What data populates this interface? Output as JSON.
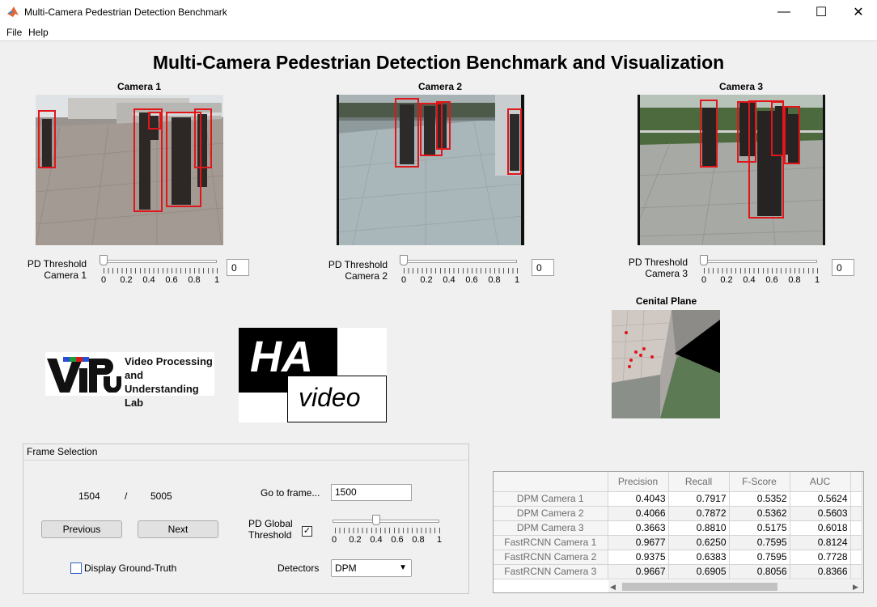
{
  "window": {
    "title": "Multi-Camera Pedestrian Detection Benchmark",
    "minimize": "—",
    "maximize": "☐",
    "close": "✕"
  },
  "menu": {
    "file": "File",
    "help": "Help"
  },
  "page_title": "Multi-Camera Pedestrian Detection Benchmark and Visualization",
  "cameras": [
    {
      "title": "Camera 1",
      "slider_label_1": "PD Threshold",
      "slider_label_2": "Camera 1",
      "value": "0",
      "level": 0
    },
    {
      "title": "Camera 2",
      "slider_label_1": "PD Threshold",
      "slider_label_2": "Camera 2",
      "value": "0",
      "level": 0
    },
    {
      "title": "Camera 3",
      "slider_label_1": "PD Threshold",
      "slider_label_2": "Camera 3",
      "value": "0",
      "level": 0
    }
  ],
  "slider_ticks": [
    "0",
    "0.2",
    "0.4",
    "0.6",
    "0.8",
    "1"
  ],
  "logos": {
    "vpu_text_1": "Video Processing",
    "vpu_text_2": "and Understanding",
    "vpu_text_3": "Lab",
    "vpu_mark": "ViPU",
    "hav_1": "HA",
    "hav_2": "video"
  },
  "cenital_title": "Cenital Plane",
  "frame_panel": {
    "title": "Frame Selection",
    "current_frame": "1504",
    "separator": "/",
    "total_frames": "5005",
    "goto_label": "Go to frame...",
    "goto_value": "1500",
    "previous": "Previous",
    "next": "Next",
    "global_threshold_1": "PD Global",
    "global_threshold_2": "Threshold",
    "global_threshold_checked": "✓",
    "global_threshold_level": 0.4,
    "display_gt": "Display Ground-Truth",
    "detectors_label": "Detectors",
    "detectors_value": "DPM",
    "dropdown_arrow": "▼"
  },
  "results_table": {
    "columns": [
      "Precision",
      "Recall",
      "F-Score",
      "AUC"
    ],
    "rows": [
      {
        "name": "DPM Camera 1",
        "values": [
          "0.4043",
          "0.7917",
          "0.5352",
          "0.5624"
        ]
      },
      {
        "name": "DPM Camera 2",
        "values": [
          "0.4066",
          "0.7872",
          "0.5362",
          "0.5603"
        ]
      },
      {
        "name": "DPM Camera 3",
        "values": [
          "0.3663",
          "0.8810",
          "0.5175",
          "0.6018"
        ]
      },
      {
        "name": "FastRCNN Camera 1",
        "values": [
          "0.9677",
          "0.6250",
          "0.7595",
          "0.8124"
        ]
      },
      {
        "name": "FastRCNN Camera 2",
        "values": [
          "0.9375",
          "0.6383",
          "0.7595",
          "0.7728"
        ]
      },
      {
        "name": "FastRCNN Camera 3",
        "values": [
          "0.9667",
          "0.6905",
          "0.8056",
          "0.8366"
        ]
      }
    ]
  }
}
